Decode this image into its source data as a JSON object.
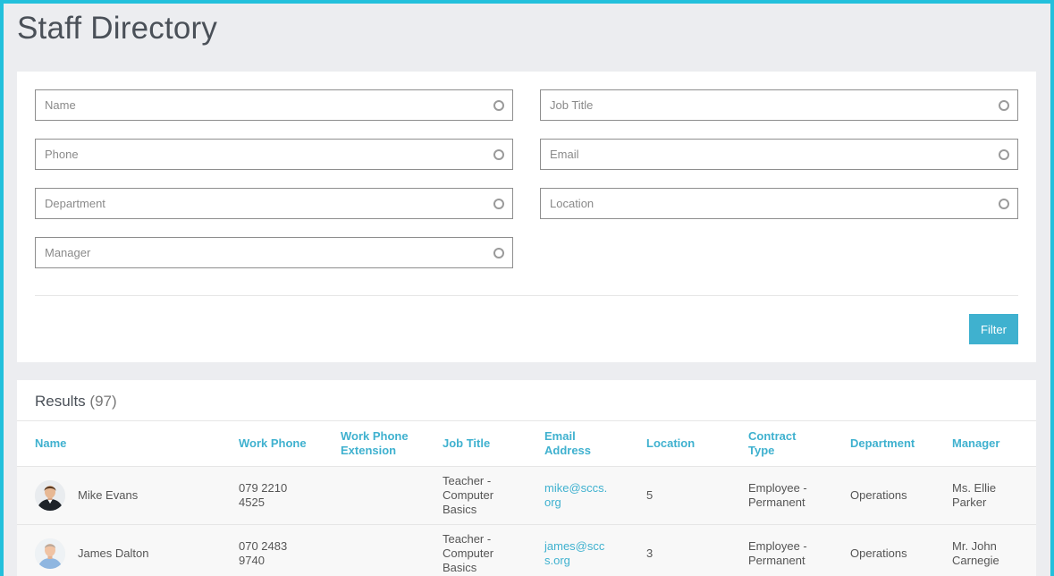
{
  "page": {
    "title": "Staff Directory"
  },
  "filters": {
    "name_placeholder": "Name",
    "job_title_placeholder": "Job Title",
    "phone_placeholder": "Phone",
    "email_placeholder": "Email",
    "department_placeholder": "Department",
    "location_placeholder": "Location",
    "manager_placeholder": "Manager",
    "filter_label": "Filter"
  },
  "results": {
    "label": "Results",
    "count": "(97)",
    "columns": {
      "name": "Name",
      "work_phone": "Work Phone",
      "work_phone_extension": "Work Phone Extension",
      "job_title": "Job Title",
      "email_address": "Email Address",
      "location": "Location",
      "contract_type": "Contract Type",
      "department": "Department",
      "manager": "Manager"
    },
    "rows": [
      {
        "name": "Mike Evans",
        "work_phone": "079 2210 4525",
        "work_phone_extension": "",
        "job_title": "Teacher - Computer Basics",
        "email": "mike@sccs.org",
        "location": "5",
        "contract_type": "Employee - Permanent",
        "department": "Operations",
        "manager": "Ms. Ellie Parker"
      },
      {
        "name": "James Dalton",
        "work_phone": "070 2483 9740",
        "work_phone_extension": "",
        "job_title": "Teacher - Computer Basics",
        "email": "james@sccs.org",
        "location": "3",
        "contract_type": "Employee - Permanent",
        "department": "Operations",
        "manager": "Mr. John Carnegie"
      }
    ]
  },
  "colors": {
    "accent": "#3fb1cf",
    "frame": "#23c0dc",
    "page_background": "#ecedf0"
  }
}
